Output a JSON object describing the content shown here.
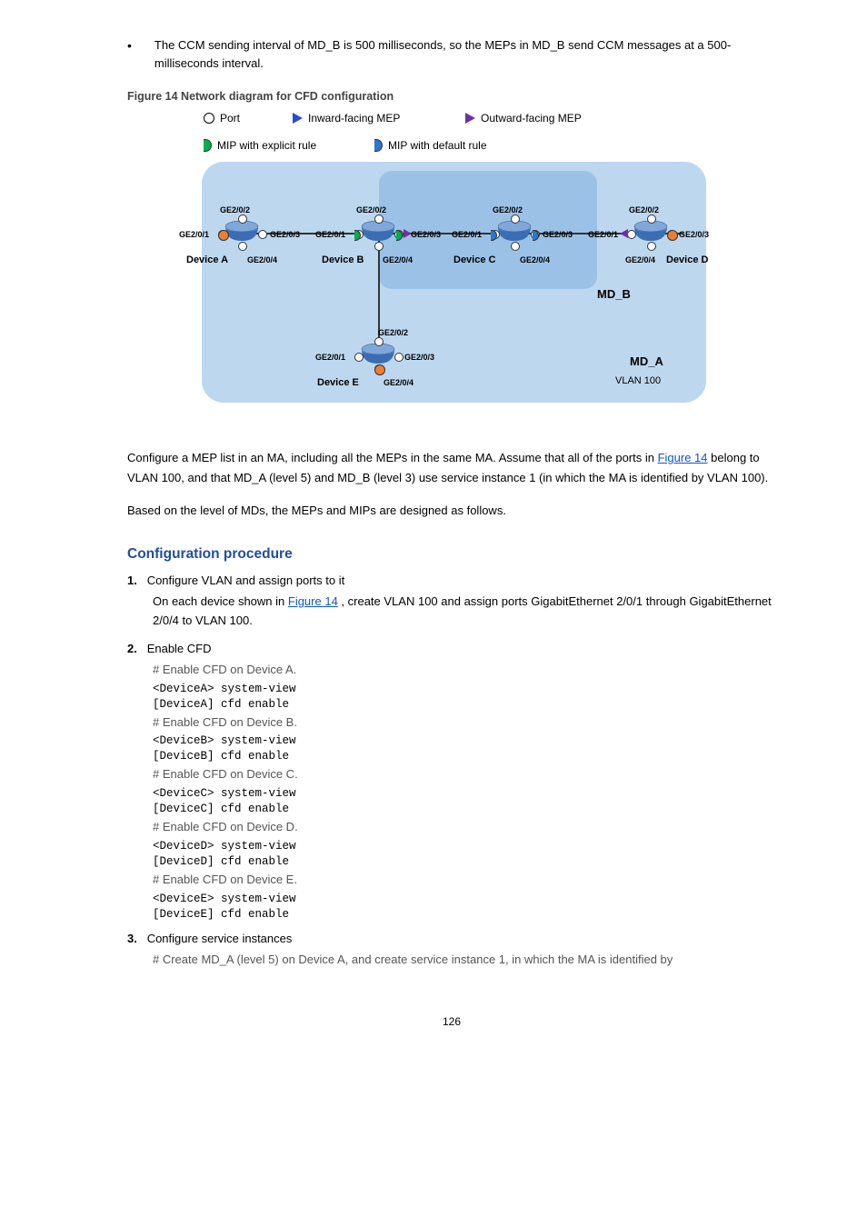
{
  "intro_bullet": "The CCM sending interval of MD_B is 500 milliseconds, so the MEPs in MD_B send CCM messages at a 500-milliseconds interval.",
  "fig_title": "Figure 14 Network diagram for CFD configuration",
  "legend": {
    "port": "Port",
    "inward_mep": "Inward-facing MEP",
    "outward_mep": "Outward-facing MEP",
    "mip_explicit": "MIP with explicit rule",
    "mip_default": "MIP with default rule"
  },
  "diagram": {
    "devA": {
      "name": "Device A",
      "p1": "GE2/0/1",
      "p2": "GE2/0/2",
      "p3": "GE2/0/3",
      "p4": "GE2/0/4"
    },
    "devB": {
      "name": "Device B",
      "p1": "GE2/0/1",
      "p2": "GE2/0/2",
      "p3": "GE2/0/3",
      "p4": "GE2/0/4"
    },
    "devC": {
      "name": "Device C",
      "p1": "GE2/0/1",
      "p2": "GE2/0/2",
      "p3": "GE2/0/3",
      "p4": "GE2/0/4"
    },
    "devD": {
      "name": "Device D",
      "p1": "GE2/0/1",
      "p2": "GE2/0/2",
      "p3": "GE2/0/3",
      "p4": "GE2/0/4"
    },
    "devE": {
      "name": "Device E",
      "p1": "GE2/0/1",
      "p2": "GE2/0/2",
      "p3": "GE2/0/3",
      "p4": "GE2/0/4"
    },
    "mdB": "MD_B",
    "mdA": "MD_A",
    "vlan": "VLAN 100"
  },
  "config_para1": "Configure a MEP list in an MA, including all the MEPs in the same MA. Assume that all of the ports in ",
  "config_link": "Figure 14",
  "config_para1b": " belong to VLAN 100, and that MD_A (level 5) and MD_B (level 3) use service instance 1 (in which the MA is identified by VLAN 100).",
  "config_para2": "Based on the level of MDs, the MEPs and MIPs are designed as follows.",
  "section": "Configuration procedure",
  "step1_head": "Configure VLAN and assign ports to it",
  "step1_body": "On each device shown in ",
  "step1_body2": ", create VLAN 100 and assign ports GigabitEthernet 2/0/1 through GigabitEthernet 2/0/4 to VLAN 100.",
  "step2_head": "Enable CFD",
  "step2_hash_a": "# Enable CFD on Device A.",
  "cmd_a1": "<DeviceA> system-view",
  "cmd_a2": "[DeviceA] cfd enable",
  "step2_hash_b": "# Enable CFD on Device B.",
  "cmd_b1": "<DeviceB> system-view",
  "cmd_b2": "[DeviceB] cfd enable",
  "step2_hash_c": "# Enable CFD on Device C.",
  "cmd_c1": "<DeviceC> system-view",
  "cmd_c2": "[DeviceC] cfd enable",
  "step2_hash_d": "# Enable CFD on Device D.",
  "cmd_d1": "<DeviceD> system-view",
  "cmd_d2": "[DeviceD] cfd enable",
  "step2_hash_e": "# Enable CFD on Device E.",
  "cmd_e1": "<DeviceE> system-view",
  "cmd_e2": "[DeviceE] cfd enable",
  "step3_head": "Configure service instances",
  "step3_hash": "# Create MD_A (level 5) on Device A, and create service instance 1, in which the MA is identified by",
  "page": "126"
}
